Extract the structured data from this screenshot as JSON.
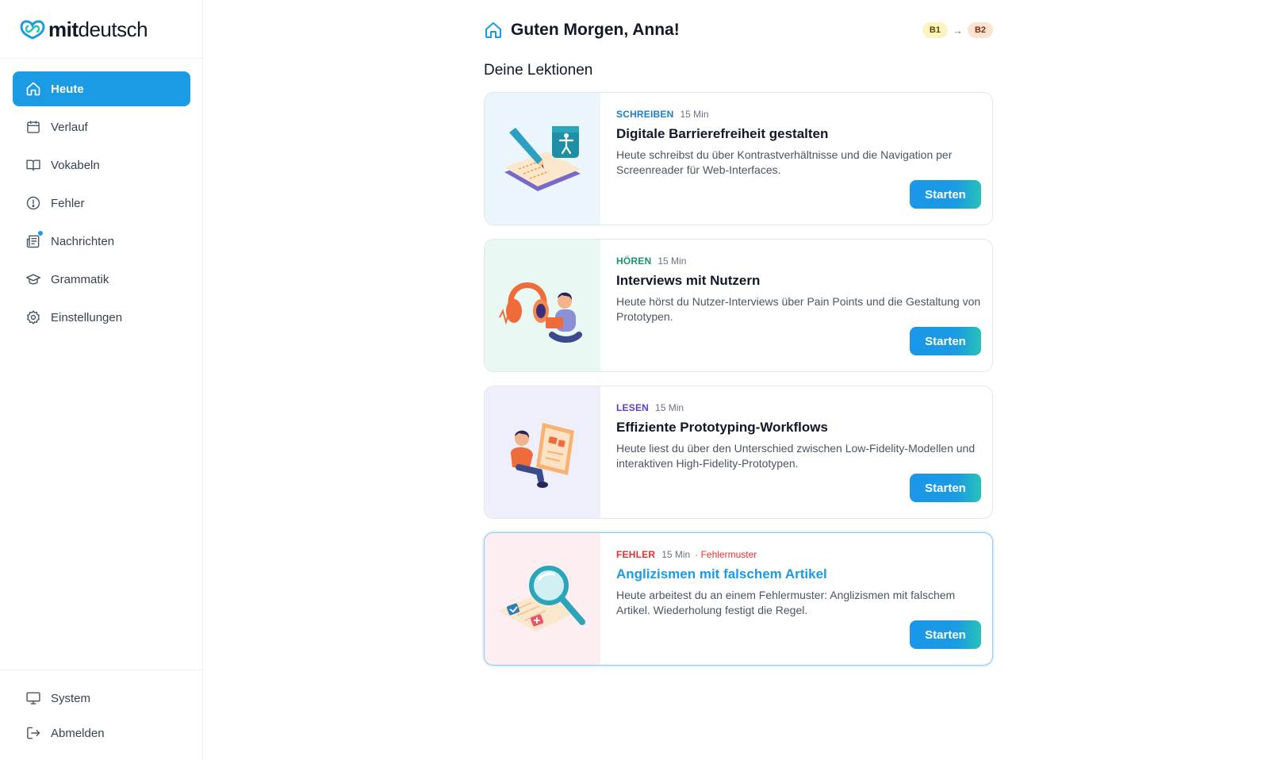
{
  "app": {
    "logo_bold": "mit",
    "logo_light": "deutsch"
  },
  "sidebar": {
    "items": [
      {
        "label": "Heute",
        "icon": "home-icon",
        "active": true
      },
      {
        "label": "Verlauf",
        "icon": "calendar-icon"
      },
      {
        "label": "Vokabeln",
        "icon": "book-icon"
      },
      {
        "label": "Fehler",
        "icon": "alert-circle-icon"
      },
      {
        "label": "Nachrichten",
        "icon": "newspaper-icon",
        "badge_dot": true
      },
      {
        "label": "Grammatik",
        "icon": "graduation-cap-icon"
      },
      {
        "label": "Einstellungen",
        "icon": "gear-icon"
      }
    ],
    "bottom_items": [
      {
        "label": "System",
        "icon": "monitor-icon"
      },
      {
        "label": "Abmelden",
        "icon": "logout-icon"
      }
    ]
  },
  "header": {
    "greeting": "Guten Morgen, Anna!",
    "level_from": "B1",
    "level_arrow": "→",
    "level_to": "B2"
  },
  "main": {
    "section_title": "Deine Lektionen",
    "lessons": [
      {
        "category": "SCHREIBEN",
        "category_color": "#1a7fd1",
        "duration": "15 Min",
        "extra": "",
        "title": "Digitale Barrierefreiheit gestalten",
        "description": "Heute schreibst du über Kontrastverhältnisse und die Navigation per Screenreader für Web-Interfaces.",
        "button": "Starten",
        "illustration": "pen-accessibility-illustration",
        "bg_color": "#eaf6fc"
      },
      {
        "category": "HÖREN",
        "category_color": "#15976c",
        "duration": "15 Min",
        "extra": "",
        "title": "Interviews mit Nutzern",
        "description": "Heute hörst du Nutzer-Interviews über Pain Points und die Gestaltung von Prototypen.",
        "button": "Starten",
        "illustration": "headphones-person-illustration",
        "bg_color": "#e9f8f3"
      },
      {
        "category": "LESEN",
        "category_color": "#5b3fd6",
        "duration": "15 Min",
        "extra": "",
        "title": "Effiziente Prototyping-Workflows",
        "description": "Heute liest du über den Unterschied zwischen Low-Fidelity-Modellen und interaktiven High-Fidelity-Prototypen.",
        "button": "Starten",
        "illustration": "reading-person-illustration",
        "bg_color": "#efeffb"
      },
      {
        "category": "FEHLER",
        "category_color": "#e03131",
        "duration": "15 Min",
        "extra": "· Fehlermuster",
        "title": "Anglizismen mit falschem Artikel",
        "description": "Heute arbeitest du an einem Fehlermuster: Anglizismen mit falschem Artikel. Wiederholung festigt die Regel.",
        "button": "Starten",
        "illustration": "magnifier-illustration",
        "bg_color": "#fdeef1",
        "highlighted": true
      }
    ]
  }
}
